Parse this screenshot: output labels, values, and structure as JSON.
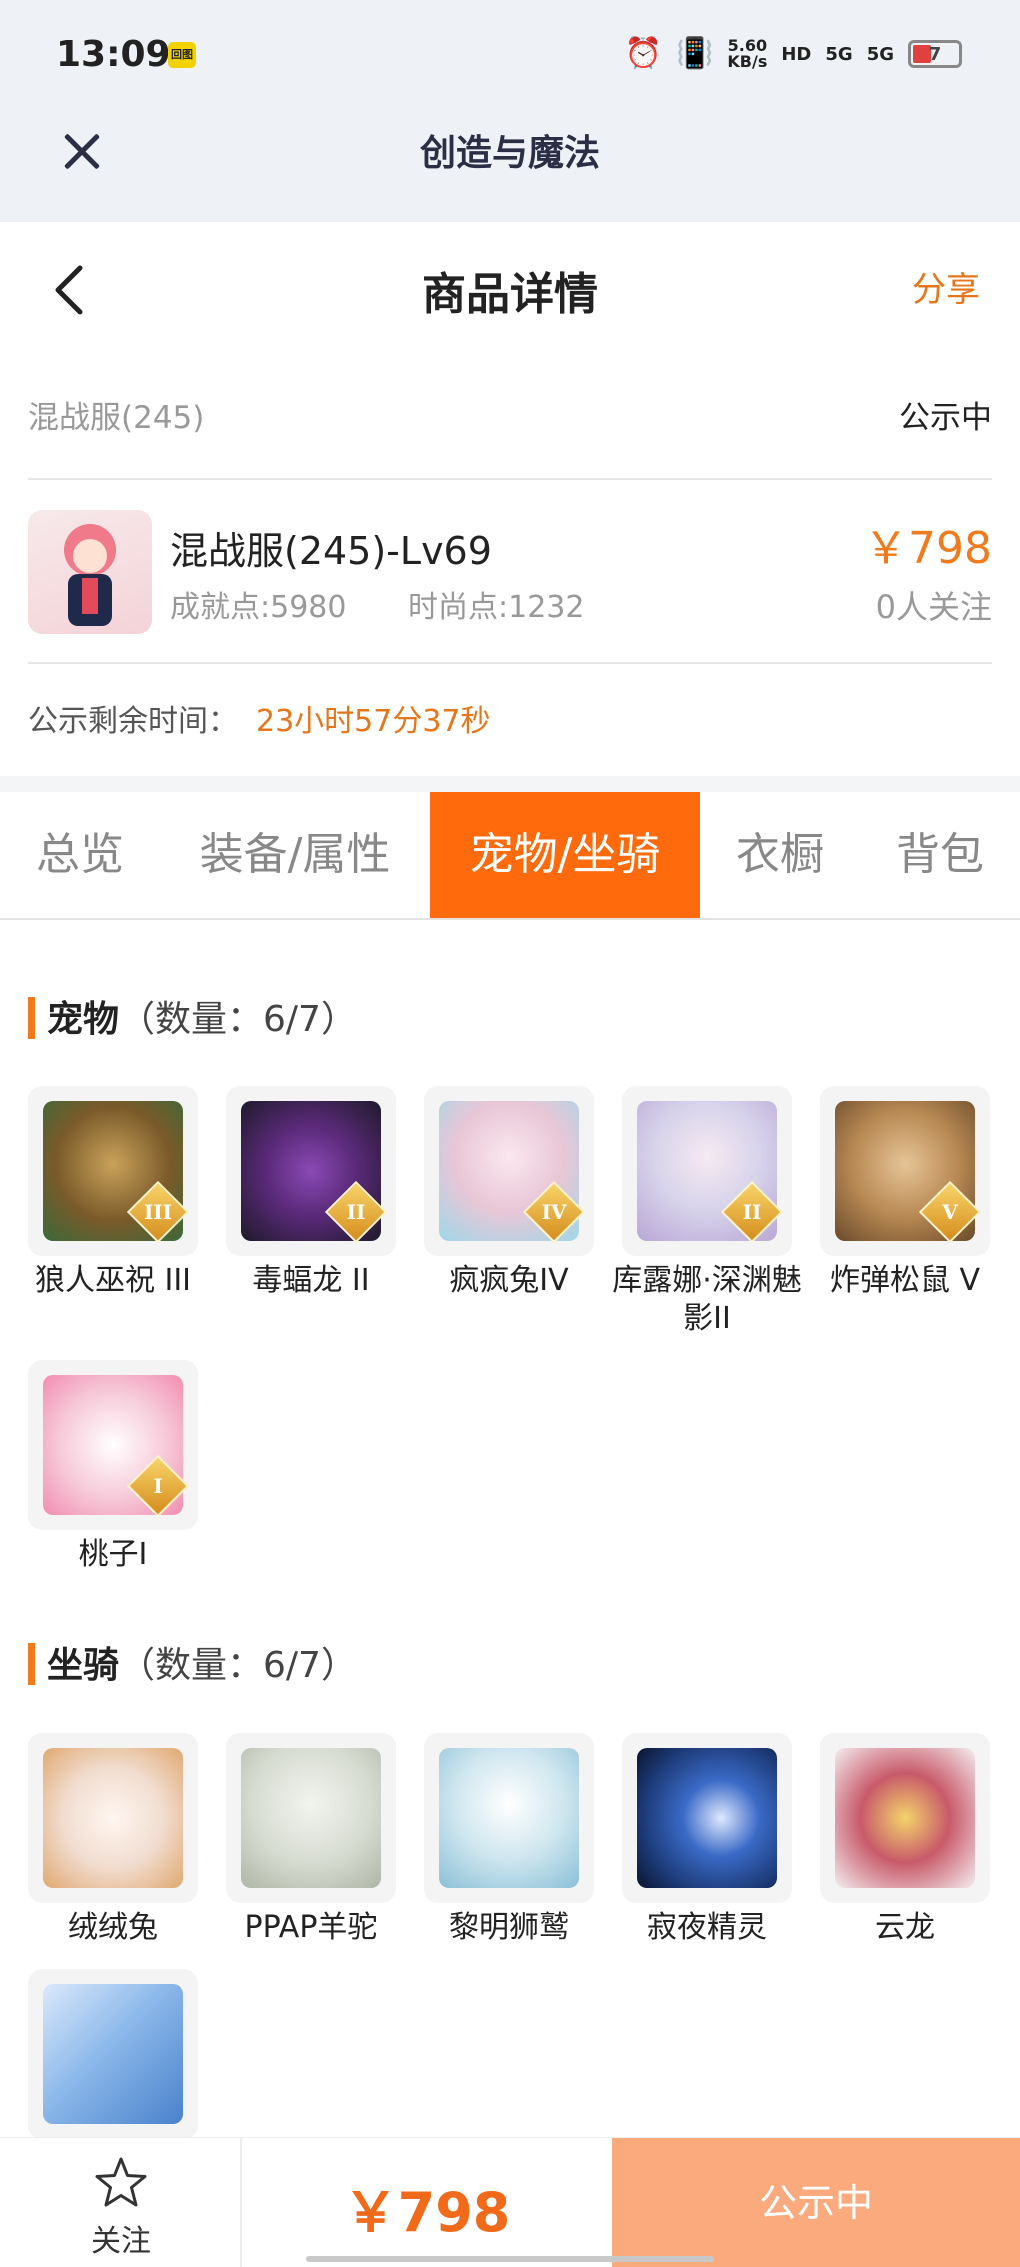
{
  "status_bar": {
    "time": "13:09",
    "badge": "回图",
    "speed_top": "5.60",
    "speed_unit": "KB/s",
    "hd": "HD",
    "net_a": "5G",
    "net_b": "5G",
    "battery": "7"
  },
  "app": {
    "title": "创造与魔法"
  },
  "page": {
    "title": "商品详情",
    "share": "分享"
  },
  "server": {
    "name": "混战服(245)",
    "status": "公示中"
  },
  "character": {
    "name": "混战服(245)-Lv69",
    "achievement": "成就点:5980",
    "fashion": "时尚点:1232",
    "price": "￥798",
    "followers": "0人关注"
  },
  "countdown": {
    "label": "公示剩余时间：",
    "value": "23小时57分37秒"
  },
  "tabs": [
    {
      "label": "总览"
    },
    {
      "label": "装备/属性"
    },
    {
      "label": "宠物/坐骑"
    },
    {
      "label": "衣橱"
    },
    {
      "label": "背包"
    }
  ],
  "active_tab": "宠物/坐骑",
  "pets": {
    "title": "宠物",
    "count": "（数量：6/7）",
    "items": [
      {
        "name": "狼人巫祝 III",
        "rank": "III",
        "color": "#7a5a2a"
      },
      {
        "name": "毒蝠龙 II",
        "rank": "II",
        "color": "#5b2a7a"
      },
      {
        "name": "疯疯兔IV",
        "rank": "IV",
        "color": "#e8c6d6"
      },
      {
        "name": "库露娜·深渊魅影II",
        "rank": "II",
        "color": "#d6d2ea"
      },
      {
        "name": "炸弹松鼠 V",
        "rank": "V",
        "color": "#b98a54"
      },
      {
        "name": "桃子I",
        "rank": "I",
        "color": "#f6c8d8"
      }
    ]
  },
  "mounts": {
    "title": "坐骑",
    "count": "（数量：6/7）",
    "items": [
      {
        "name": "绒绒兔",
        "color": "#f1ddd0"
      },
      {
        "name": "PPAP羊驼",
        "color": "#d6dbd0"
      },
      {
        "name": "黎明狮鹫",
        "color": "#cfe6ef"
      },
      {
        "name": "寂夜精灵",
        "color": "#1d3c7a"
      },
      {
        "name": "云龙",
        "color": "#c85a6a"
      },
      {
        "name": "",
        "color": "#8cb8ea"
      }
    ]
  },
  "bottom": {
    "follow": "关注",
    "price": "￥798",
    "status": "公示中"
  }
}
